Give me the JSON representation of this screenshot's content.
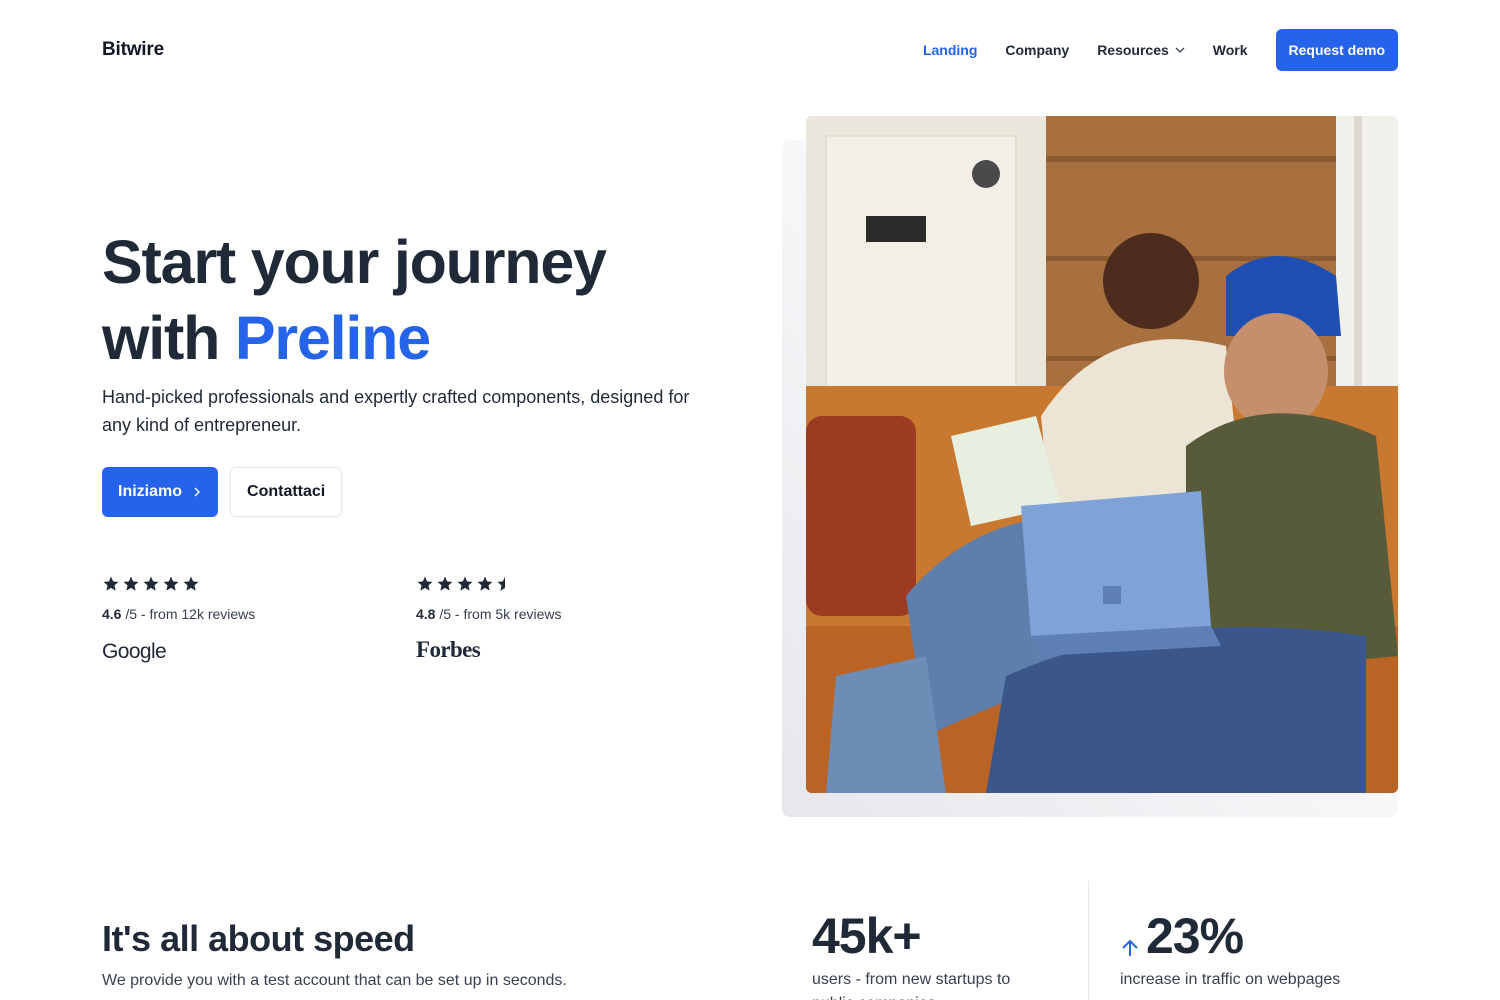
{
  "header": {
    "brand": "Bitwire",
    "nav": [
      {
        "label": "Landing",
        "active": true
      },
      {
        "label": "Company"
      },
      {
        "label": "Resources",
        "dropdown": true
      },
      {
        "label": "Work"
      }
    ],
    "cta": "Request demo"
  },
  "hero": {
    "title_line1": "Start your journey",
    "title_line2_prefix": "with ",
    "title_accent": "Preline",
    "subtitle": "Hand-picked professionals and expertly crafted components, designed for any kind of entrepreneur.",
    "primary_button": "Iniziamo",
    "secondary_button": "Contattaci",
    "ratings": [
      {
        "score": "4.6",
        "suffix": "/5 - from 12k reviews",
        "stars": 5,
        "brand": "Google"
      },
      {
        "score": "4.8",
        "suffix": "/5 - from 5k reviews",
        "stars": 4.5,
        "brand": "Forbes"
      }
    ]
  },
  "speed": {
    "title": "It's all about speed",
    "subtitle": "We provide you with a test account that can be set up in seconds.",
    "stats": [
      {
        "value": "45k+",
        "description": "users - from new startups to public companies"
      },
      {
        "value": "23%",
        "description": "increase in traffic on webpages",
        "trend": "up"
      }
    ]
  },
  "colors": {
    "accent": "#2563eb",
    "text": "#1f2937"
  },
  "icons": [
    "chevron-down-icon",
    "chevron-right-icon",
    "star-icon",
    "half-star-icon",
    "arrow-up-icon"
  ]
}
